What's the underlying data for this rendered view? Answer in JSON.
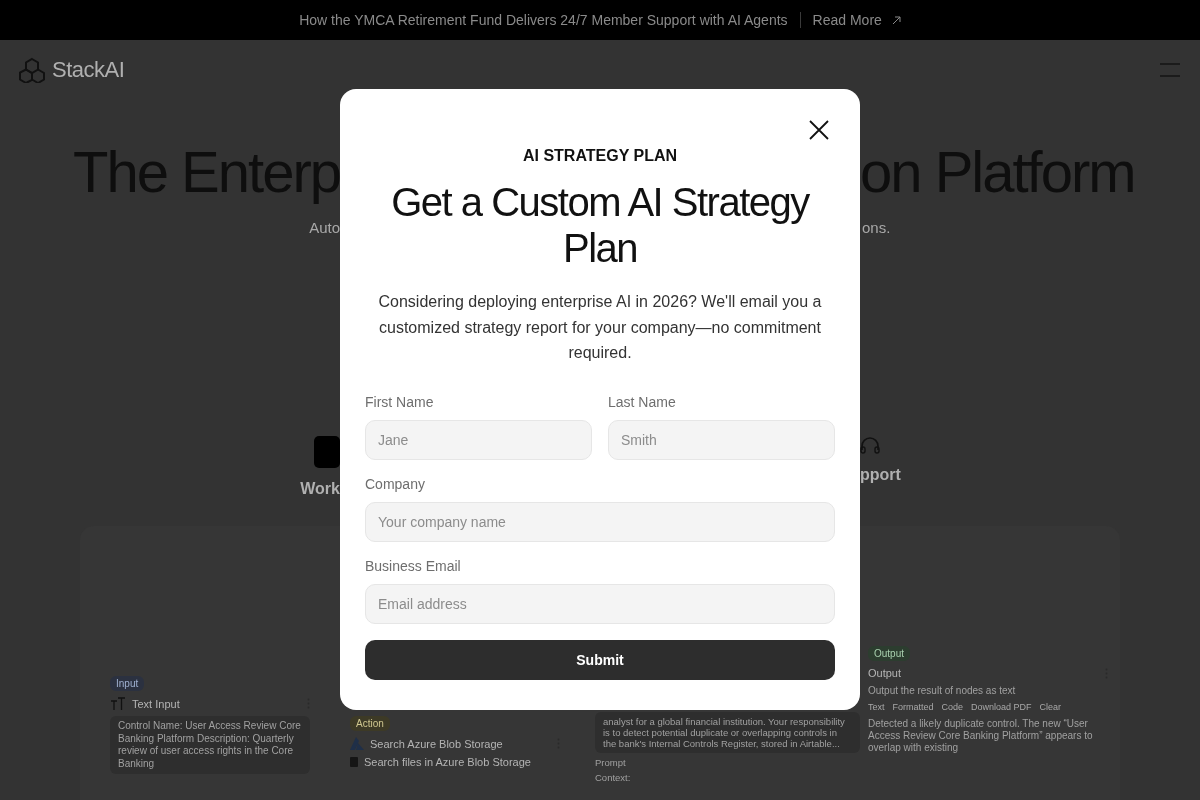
{
  "banner": {
    "text": "How the YMCA Retirement Fund Delivers 24/7 Member Support with AI Agents",
    "link": "Read More"
  },
  "header": {
    "logo": "StackAI"
  },
  "hero": {
    "title_left": "The Enterp",
    "title_right": "on Platform",
    "subtitle_left": "Auto",
    "subtitle_right": "ons."
  },
  "tabs": [
    {
      "label": "Work"
    },
    {
      "label": "pport"
    }
  ],
  "workflow": {
    "nodes": [
      {
        "kind": "input",
        "tag": "Input",
        "title": "Text Input",
        "body": "Control Name: User Access Review Core Banking Platform Description: Quarterly review of user access rights in the Core Banking"
      },
      {
        "kind": "action",
        "tag": "Action",
        "title": "Search Azure Blob Storage",
        "subtitle": "Search files in Azure Blob Storage"
      },
      {
        "kind": "llm",
        "body": "analyst for a global financial institution. Your responsibility is to detect potential duplicate or overlapping controls in the bank's Internal Controls Register, stored in Airtable...",
        "prompt_label": "Prompt",
        "context_label": "Context:"
      },
      {
        "kind": "output",
        "tag": "Output",
        "title": "Output",
        "subtitle": "Output the result of nodes as text",
        "toolbar": [
          "Text",
          "Formatted",
          "Code",
          "Download PDF",
          "Clear"
        ],
        "body": "Detected a likely duplicate control. The new “User Access Review Core Banking Platform” appears to overlap with existing"
      }
    ]
  },
  "modal": {
    "kicker": "AI STRATEGY PLAN",
    "title": "Get a Custom AI Strategy Plan",
    "description": "Considering deploying enterprise AI in 2026? We'll email you a customized strategy report for your company—no commitment required.",
    "rows": [
      [
        {
          "label": "First Name",
          "placeholder": "Jane"
        },
        {
          "label": "Last Name",
          "placeholder": "Smith"
        }
      ],
      [
        {
          "label": "Company",
          "placeholder": "Your company name"
        }
      ],
      [
        {
          "label": "Business Email",
          "placeholder": "Email address"
        }
      ]
    ],
    "submit": "Submit"
  }
}
